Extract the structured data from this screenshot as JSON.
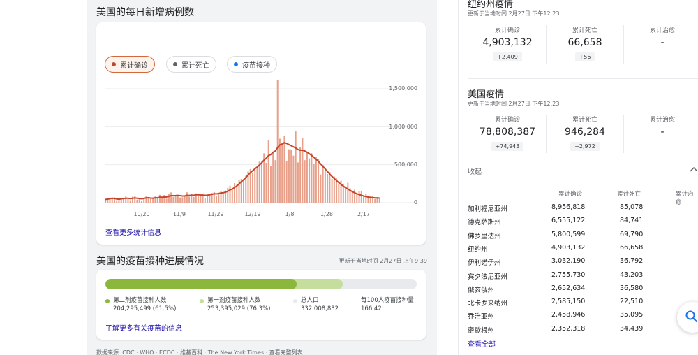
{
  "cases_section": {
    "title": "美国的每日新增病例数",
    "chips": [
      {
        "label": "累计确诊",
        "color": "#c5442a",
        "active": true
      },
      {
        "label": "累计死亡",
        "color": "#5f6368",
        "active": false
      },
      {
        "label": "疫苗接种",
        "color": "#1a73e8",
        "active": false
      }
    ],
    "more_stats_link": "查看更多统计信息"
  },
  "chart_data": {
    "type": "bar",
    "title": "",
    "xlabel": "",
    "ylabel": "",
    "ylim": [
      0,
      1500000
    ],
    "y_ticks": [
      "1,500,000",
      "1,000,000",
      "500,000",
      "0"
    ],
    "x_ticks": [
      "10/20",
      "11/9",
      "11/29",
      "12/19",
      "1/8",
      "1/28",
      "2/17"
    ],
    "bar_color": "#e8a08a",
    "avg_line_color": "#c5442a",
    "series": [
      {
        "values": [
          47000,
          55000,
          40000,
          68000,
          70000,
          30000,
          36000,
          55000,
          60000,
          80000,
          44000,
          32000,
          78000,
          83000,
          38000,
          63000,
          25000,
          58000,
          82000,
          74000,
          48000,
          54000,
          81000,
          55000,
          103000,
          62000,
          102000,
          52000,
          116000,
          135000,
          78000,
          85000,
          98000,
          68000,
          70000,
          82000,
          136000,
          80000,
          112000,
          75000,
          122000,
          90000,
          85000,
          103000,
          62000,
          92000,
          115000,
          128000,
          140000,
          82000,
          130000,
          155000,
          110000,
          160000,
          196000,
          223000,
          175000,
          257000,
          234000,
          305000,
          313000,
          291000,
          352000,
          412000,
          443000,
          390000,
          436000,
          475000,
          541000,
          540000,
          650000,
          525000,
          820000,
          480000,
          660000,
          560000,
          1620000,
          842000,
          780000,
          880000,
          548000,
          703000,
          700000,
          620000,
          938000,
          530000,
          728000,
          850000,
          560000,
          670000,
          584000,
          652000,
          512000,
          600000,
          570000,
          372000,
          498000,
          414000,
          377000,
          405000,
          315000,
          345000,
          320000,
          240000,
          290000,
          250000,
          200000,
          262000,
          190000,
          158000,
          170000,
          120000,
          148000,
          155000,
          95000,
          115000,
          86000,
          63000,
          92000,
          50000,
          72000,
          60000
        ]
      },
      {
        "values": [
          42000,
          46000,
          52000,
          57000,
          55000,
          48000,
          45000,
          50000,
          54000,
          58000,
          57000,
          53000,
          58000,
          62000,
          58000,
          55000,
          51000,
          56000,
          62000,
          64000,
          60000,
          59000,
          64000,
          63000,
          72000,
          71000,
          74000,
          75000,
          83000,
          92000,
          92000,
          93000,
          96000,
          92000,
          88000,
          88000,
          96000,
          94000,
          98000,
          97000,
          104000,
          103000,
          101000,
          100000,
          96000,
          98000,
          104000,
          109000,
          117000,
          115000,
          120000,
          128000,
          130000,
          138000,
          150000,
          168000,
          180000,
          200000,
          220000,
          248000,
          276000,
          302000,
          332000,
          366000,
          396000,
          420000,
          447000,
          470000,
          497000,
          525000,
          560000,
          585000,
          620000,
          633000,
          664000,
          680000,
          725000,
          760000,
          771000,
          790000,
          780000,
          765000,
          750000,
          735000,
          720000,
          700000,
          690000,
          690000,
          680000,
          665000,
          645000,
          623000,
          598000,
          572000,
          545000,
          510000,
          478000,
          445000,
          410000,
          378000,
          346000,
          318000,
          292000,
          264000,
          240000,
          218000,
          198000,
          180000,
          162000,
          145000,
          130000,
          117000,
          106000,
          96000,
          88000,
          80000,
          74000,
          70000,
          66000,
          63000,
          62000,
          61000
        ]
      }
    ]
  },
  "vaccine_section": {
    "title": "美国的疫苗接种进展情况",
    "updated": "更新于当地时间 2月27日 上午9:39",
    "second_dose_pct": 0.615,
    "first_dose_pct": 0.763,
    "legend": [
      {
        "label": "第二剂疫苗接种人数",
        "value": "204,295,499 (61.5%)",
        "color": "#8bb83c"
      },
      {
        "label": "第一剂疫苗接种人数",
        "value": "253,395,029 (76.3%)",
        "color": "#c5dd9d"
      },
      {
        "label": "总人口",
        "value": "332,008,832",
        "color": "#e8eaed"
      },
      {
        "label": "每100人疫苗接种量",
        "value": "166.42",
        "color": ""
      }
    ],
    "more_link": "了解更多有关疫苗的信息"
  },
  "source_text": "数据来源: CDC · WHO · ECDC · 维基百科 · The New York Times · 查看完整列表",
  "ny_section": {
    "title": "纽约州疫情",
    "updated": "更新于当地时间 2月27日 下午12:23",
    "stats": [
      {
        "label": "累计确诊",
        "value": "4,903,132",
        "delta": "+2,409"
      },
      {
        "label": "累计死亡",
        "value": "66,658",
        "delta": "+56"
      },
      {
        "label": "累计治愈",
        "value": "-",
        "delta": ""
      }
    ]
  },
  "us_section": {
    "title": "美国疫情",
    "updated": "更新于当地时间 2月27日 下午12:23",
    "stats": [
      {
        "label": "累计确诊",
        "value": "78,808,387",
        "delta": "+74,943"
      },
      {
        "label": "累计死亡",
        "value": "946,284",
        "delta": "+2,972"
      },
      {
        "label": "累计治愈",
        "value": "-",
        "delta": ""
      }
    ],
    "collapse_label": "收起"
  },
  "state_table": {
    "headers": [
      "累计确诊",
      "累计死亡",
      "累计治愈"
    ],
    "rows": [
      {
        "state": "加利福尼亚州",
        "cases": "8,956,818",
        "deaths": "85,078"
      },
      {
        "state": "德克萨斯州",
        "cases": "6,555,122",
        "deaths": "84,741"
      },
      {
        "state": "佛罗里达州",
        "cases": "5,800,599",
        "deaths": "69,790"
      },
      {
        "state": "纽约州",
        "cases": "4,903,132",
        "deaths": "66,658"
      },
      {
        "state": "伊利诺伊州",
        "cases": "3,032,190",
        "deaths": "36,792"
      },
      {
        "state": "宾夕法尼亚州",
        "cases": "2,755,730",
        "deaths": "43,203"
      },
      {
        "state": "俄亥俄州",
        "cases": "2,652,634",
        "deaths": "36,580"
      },
      {
        "state": "北卡罗来纳州",
        "cases": "2,585,150",
        "deaths": "22,510"
      },
      {
        "state": "乔治亚州",
        "cases": "2,458,946",
        "deaths": "35,095"
      },
      {
        "state": "密歇根州",
        "cases": "2,352,318",
        "deaths": "34,439"
      }
    ],
    "view_all": "查看全部"
  }
}
